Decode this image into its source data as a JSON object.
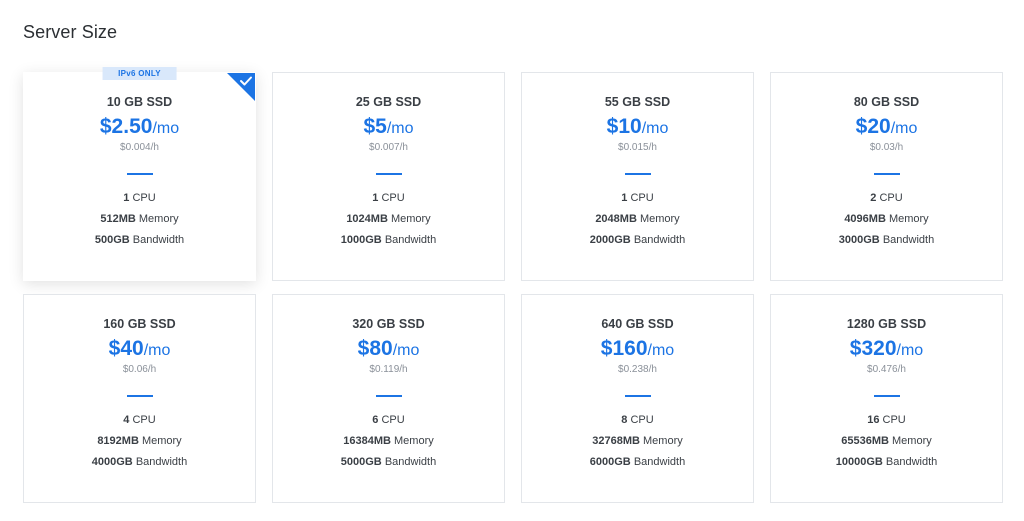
{
  "page": {
    "title": "Server Size"
  },
  "accent_color": "#1c74e4",
  "plans": [
    {
      "storage": "10 GB SSD",
      "price": "$2.50",
      "price_unit": "/mo",
      "hourly": "$0.004/h",
      "cpu": "1",
      "cpu_label": "CPU",
      "memory": "512MB",
      "memory_label": "Memory",
      "bandwidth": "500GB",
      "bandwidth_label": "Bandwidth",
      "badge": "IPv6 ONLY",
      "selected": true
    },
    {
      "storage": "25 GB SSD",
      "price": "$5",
      "price_unit": "/mo",
      "hourly": "$0.007/h",
      "cpu": "1",
      "cpu_label": "CPU",
      "memory": "1024MB",
      "memory_label": "Memory",
      "bandwidth": "1000GB",
      "bandwidth_label": "Bandwidth",
      "selected": false
    },
    {
      "storage": "55 GB SSD",
      "price": "$10",
      "price_unit": "/mo",
      "hourly": "$0.015/h",
      "cpu": "1",
      "cpu_label": "CPU",
      "memory": "2048MB",
      "memory_label": "Memory",
      "bandwidth": "2000GB",
      "bandwidth_label": "Bandwidth",
      "selected": false
    },
    {
      "storage": "80 GB SSD",
      "price": "$20",
      "price_unit": "/mo",
      "hourly": "$0.03/h",
      "cpu": "2",
      "cpu_label": "CPU",
      "memory": "4096MB",
      "memory_label": "Memory",
      "bandwidth": "3000GB",
      "bandwidth_label": "Bandwidth",
      "selected": false
    },
    {
      "storage": "160 GB SSD",
      "price": "$40",
      "price_unit": "/mo",
      "hourly": "$0.06/h",
      "cpu": "4",
      "cpu_label": "CPU",
      "memory": "8192MB",
      "memory_label": "Memory",
      "bandwidth": "4000GB",
      "bandwidth_label": "Bandwidth",
      "selected": false
    },
    {
      "storage": "320 GB SSD",
      "price": "$80",
      "price_unit": "/mo",
      "hourly": "$0.119/h",
      "cpu": "6",
      "cpu_label": "CPU",
      "memory": "16384MB",
      "memory_label": "Memory",
      "bandwidth": "5000GB",
      "bandwidth_label": "Bandwidth",
      "selected": false
    },
    {
      "storage": "640 GB SSD",
      "price": "$160",
      "price_unit": "/mo",
      "hourly": "$0.238/h",
      "cpu": "8",
      "cpu_label": "CPU",
      "memory": "32768MB",
      "memory_label": "Memory",
      "bandwidth": "6000GB",
      "bandwidth_label": "Bandwidth",
      "selected": false
    },
    {
      "storage": "1280 GB SSD",
      "price": "$320",
      "price_unit": "/mo",
      "hourly": "$0.476/h",
      "cpu": "16",
      "cpu_label": "CPU",
      "memory": "65536MB",
      "memory_label": "Memory",
      "bandwidth": "10000GB",
      "bandwidth_label": "Bandwidth",
      "selected": false
    }
  ],
  "icons": {
    "selected_indicator": "checkmark-icon"
  }
}
